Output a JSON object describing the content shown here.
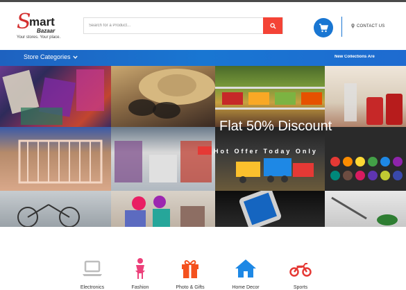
{
  "brand": {
    "logo_s": "S",
    "logo_mart": "mart",
    "logo_bazaar": "Bazaar",
    "tagline": "Your stores. Your place."
  },
  "search": {
    "placeholder": "Search for a Product...",
    "value": ""
  },
  "header": {
    "contact_label": "CONTACT US"
  },
  "nav": {
    "categories_label": "Store Categories",
    "collections_label": "New Collections Are"
  },
  "hero": {
    "title": "Flat 50% Discount",
    "subtitle": "Hot Offer Today Only"
  },
  "categories": [
    {
      "label": "Electronics",
      "icon": "laptop-icon",
      "color": "#bdbdbd"
    },
    {
      "label": "Fashion",
      "icon": "person-icon",
      "color": "#ec407a"
    },
    {
      "label": "Photo & Gifts",
      "icon": "gift-icon",
      "color": "#f4511e"
    },
    {
      "label": "Home Decor",
      "icon": "home-icon",
      "color": "#1e88e5"
    },
    {
      "label": "Sports",
      "icon": "motorbike-icon",
      "color": "#e53935"
    }
  ],
  "colors": {
    "accent_blue": "#1976d2",
    "search_red": "#f44336",
    "logo_red": "#d32f2f"
  }
}
